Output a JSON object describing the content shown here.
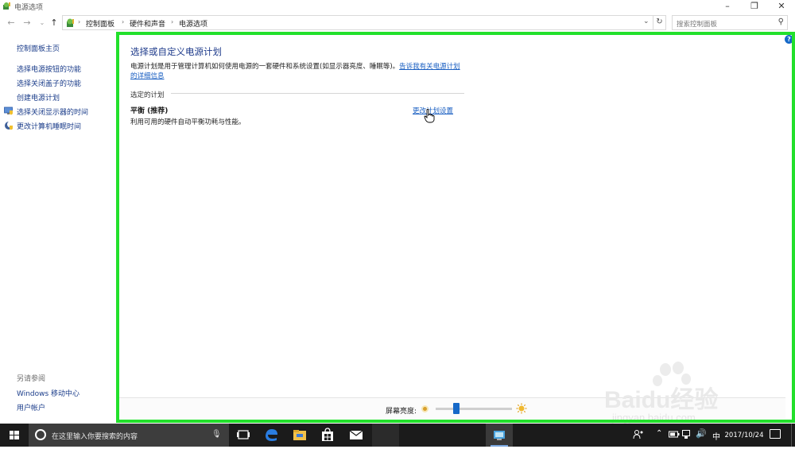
{
  "window": {
    "title": "电源选项"
  },
  "address": {
    "crumbs": [
      "控制面板",
      "硬件和声音",
      "电源选项"
    ],
    "search_placeholder": "搜索控制面板"
  },
  "sidebar": {
    "items": [
      {
        "label": "控制面板主页",
        "icon": null
      },
      {
        "label": "选择电源按钮的功能",
        "icon": null
      },
      {
        "label": "选择关闭盖子的功能",
        "icon": null
      },
      {
        "label": "创建电源计划",
        "icon": null
      },
      {
        "label": "选择关闭显示器的时间",
        "icon": "monitor-shield-icon"
      },
      {
        "label": "更改计算机睡眠时间",
        "icon": "moon-shield-icon"
      }
    ],
    "see_also_title": "另请参阅",
    "see_also": [
      "Windows 移动中心",
      "用户帐户"
    ]
  },
  "main": {
    "heading": "选择或自定义电源计划",
    "description": "电源计划是用于管理计算机如何使用电源的一套硬件和系统设置(如显示器亮度、睡眠等)。",
    "description_link": "告诉我有关电源计划的详细信息",
    "selected_plan_label": "选定的计划",
    "plan_name": "平衡 (推荐)",
    "plan_description": "利用可用的硬件自动平衡功耗与性能。",
    "plan_link": "更改计划设置"
  },
  "brightness": {
    "label": "屏幕亮度:",
    "level": 0.25
  },
  "watermark": {
    "text": "Baidu经验",
    "url": "jingyan.baidu.com"
  },
  "taskbar": {
    "search_placeholder": "在这里输入你要搜索的内容",
    "apps": [
      "task-view-icon",
      "edge-icon",
      "file-explorer-icon",
      "store-icon",
      "mail-icon",
      "control-panel-icon"
    ],
    "ime": "中",
    "date": "2017/10/24"
  },
  "colors": {
    "highlight": "#22e02b",
    "link": "#1a5fc2",
    "heading": "#1e3b8b",
    "taskbar": "#1b1b1b"
  }
}
